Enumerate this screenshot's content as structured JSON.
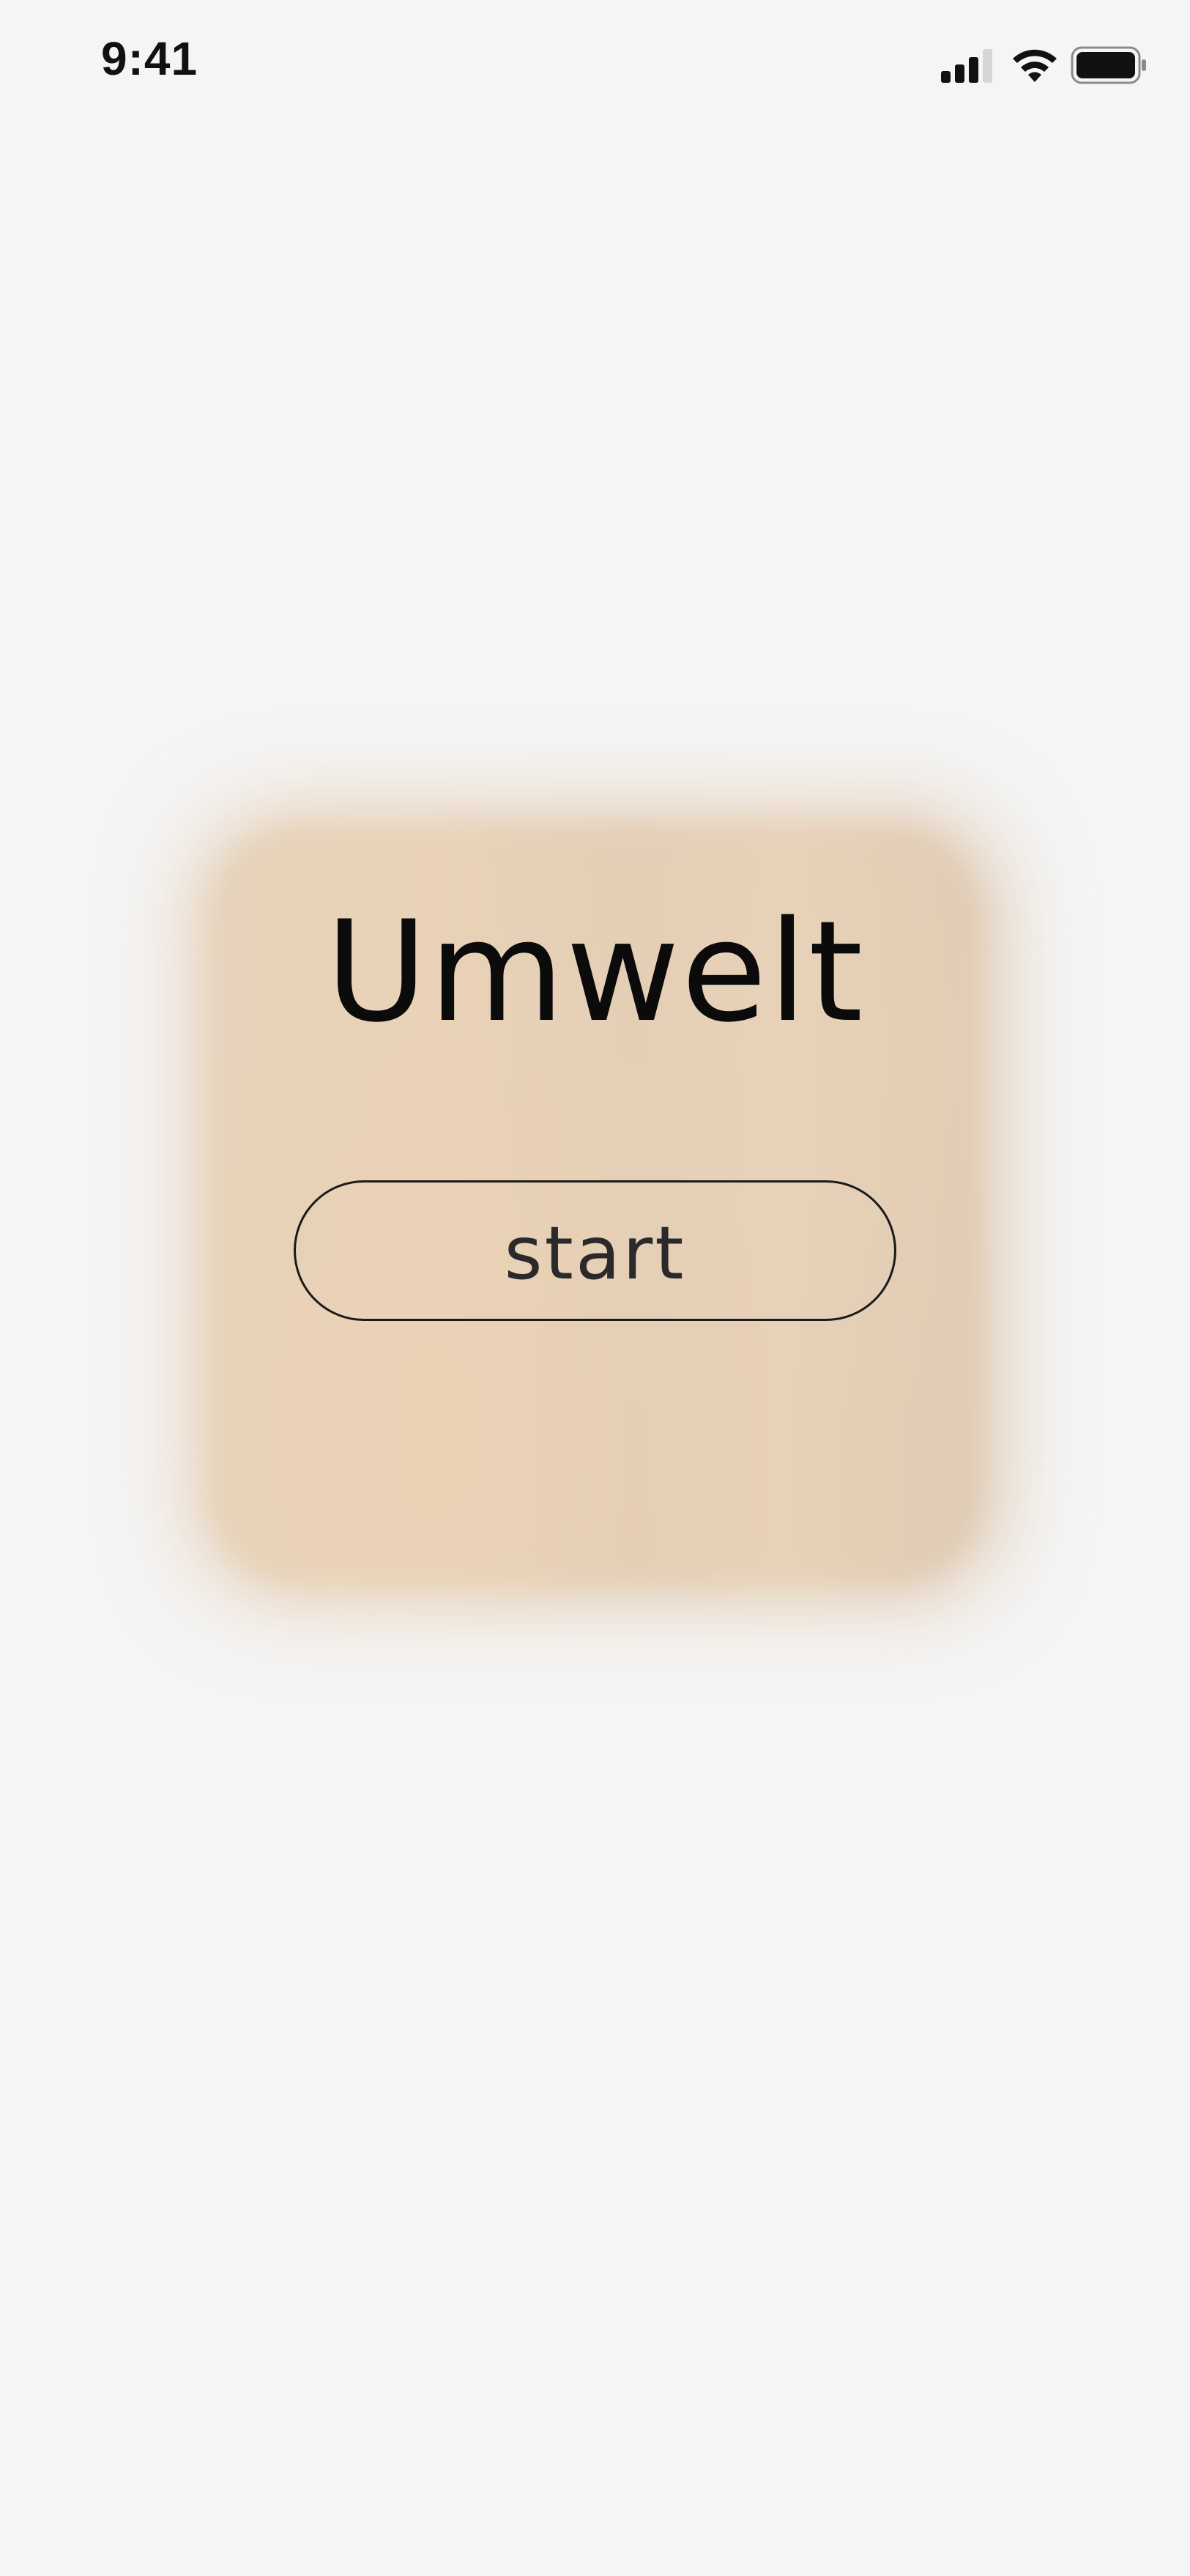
{
  "status_bar": {
    "time": "9:41",
    "icons": [
      "cellular-signal-icon",
      "wifi-icon",
      "battery-icon"
    ]
  },
  "app": {
    "title": "Umwelt",
    "start_label": "start"
  },
  "colors": {
    "background": "#f5f5f5",
    "card": "#e6d1b8",
    "text": "#0b0b0b",
    "button_border": "#1a1a1a"
  }
}
